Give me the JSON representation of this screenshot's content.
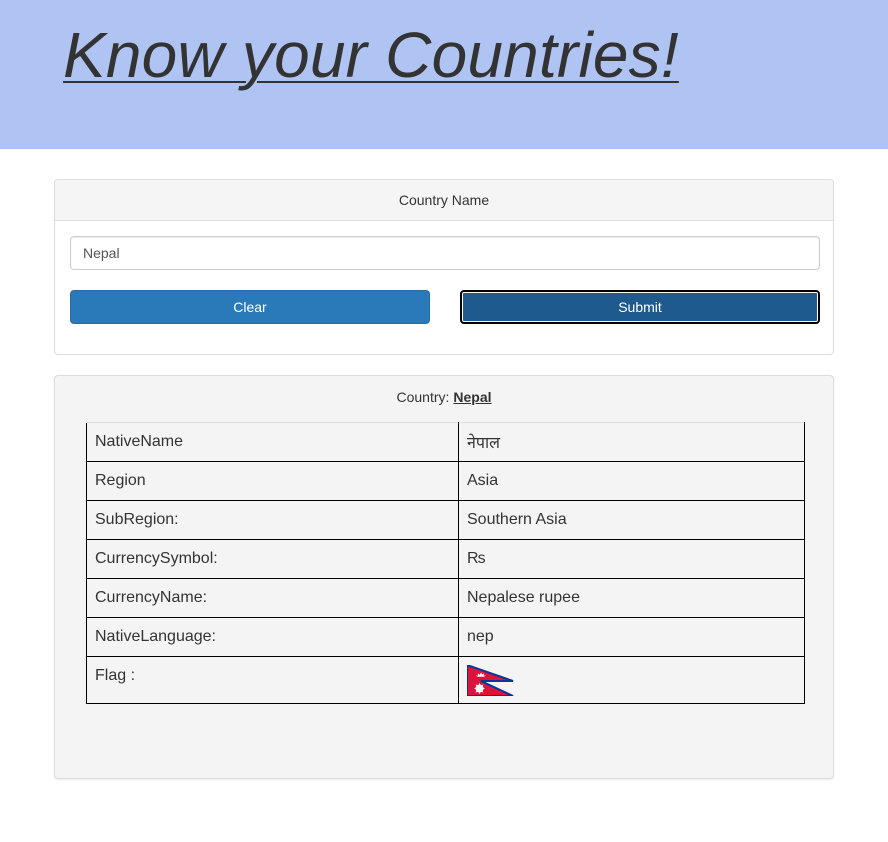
{
  "header": {
    "title": "Know your Countries!"
  },
  "search": {
    "heading": "Country Name",
    "input_value": "Nepal",
    "clear_label": "Clear",
    "submit_label": "Submit"
  },
  "result": {
    "heading_prefix": "Country:",
    "country_name": "Nepal",
    "rows": [
      {
        "key": "NativeName",
        "value": "नेपाल"
      },
      {
        "key": "Region",
        "value": "Asia"
      },
      {
        "key": "SubRegion:",
        "value": "Southern Asia"
      },
      {
        "key": "CurrencySymbol:",
        "value": "₨"
      },
      {
        "key": "CurrencyName:",
        "value": "Nepalese rupee"
      },
      {
        "key": "NativeLanguage:",
        "value": "nep"
      },
      {
        "key": "Flag :",
        "value": ""
      }
    ],
    "flag_icon": "nepal-flag-icon"
  },
  "colors": {
    "banner": "#afc4f3",
    "clear_button": "#2a7ab9",
    "submit_button": "#1f5a8e",
    "flag_red": "#dc143c",
    "flag_blue": "#003893"
  }
}
